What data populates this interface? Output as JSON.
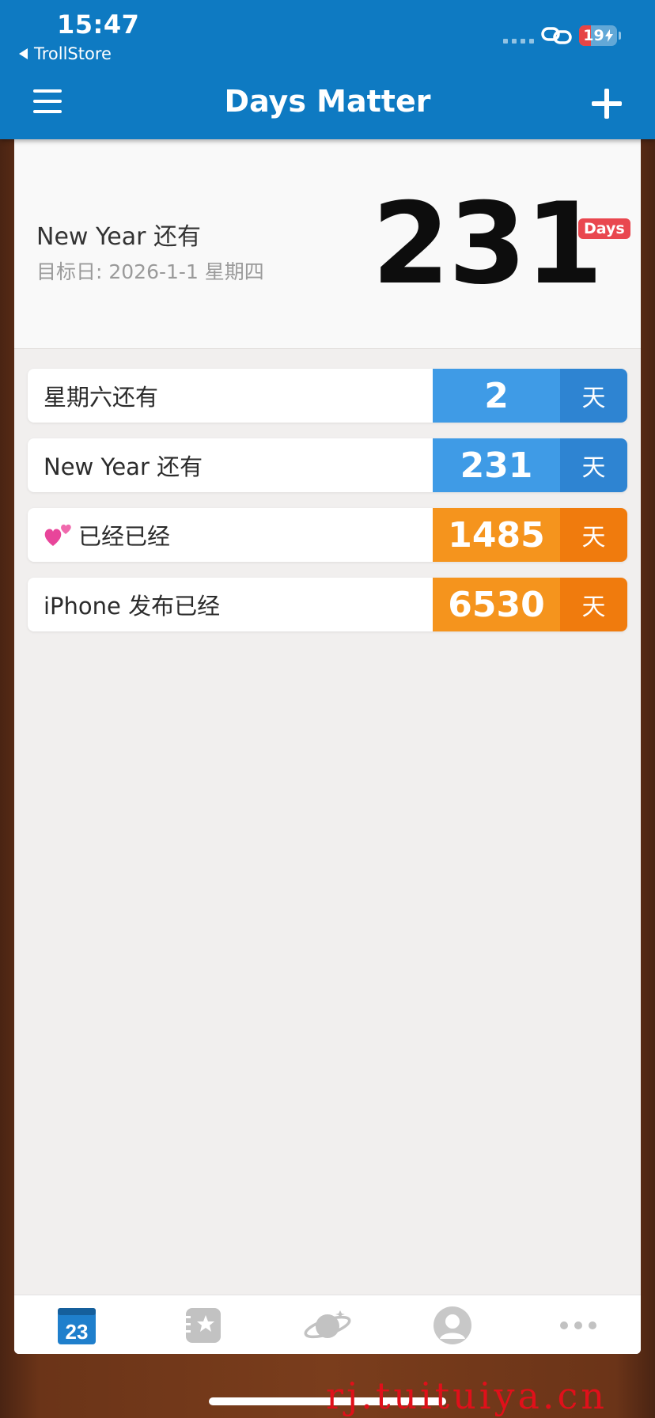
{
  "status_bar": {
    "time": "15:47",
    "back_app": "TrollStore",
    "battery": "19",
    "battery_level_percent": 19
  },
  "nav": {
    "title": "Days Matter",
    "menu_icon": "hamburger-menu-icon",
    "add_icon": "plus-icon"
  },
  "hero": {
    "title": "New Year 还有",
    "subtitle": "目标日: 2026-1-1 星期四",
    "count": "231",
    "unit": "Days"
  },
  "events": [
    {
      "label": "星期六还有",
      "count": "2",
      "unit": "天",
      "color": "#3f9be6",
      "emoji": false
    },
    {
      "label": "New Year 还有",
      "count": "231",
      "unit": "天",
      "color": "#3f9be6",
      "emoji": false
    },
    {
      "label": "已经已经",
      "count": "1485",
      "unit": "天",
      "color": "#f5941d",
      "emoji": true
    },
    {
      "label": "iPhone 发布已经",
      "count": "6530",
      "unit": "天",
      "color": "#f5941d",
      "emoji": false
    }
  ],
  "tabs": [
    {
      "icon": "calendar-icon",
      "label": "23",
      "active": true
    },
    {
      "icon": "star-list-icon",
      "active": false
    },
    {
      "icon": "planet-icon",
      "active": false
    },
    {
      "icon": "profile-icon",
      "active": false
    },
    {
      "icon": "more-icon",
      "active": false
    }
  ],
  "watermark": "rj.tuituiya.cn",
  "colors": {
    "nav_blue": "#0e7ac2",
    "count_blue": "#3f9be6",
    "count_orange": "#f5941d",
    "badge_red": "#e9474f"
  }
}
